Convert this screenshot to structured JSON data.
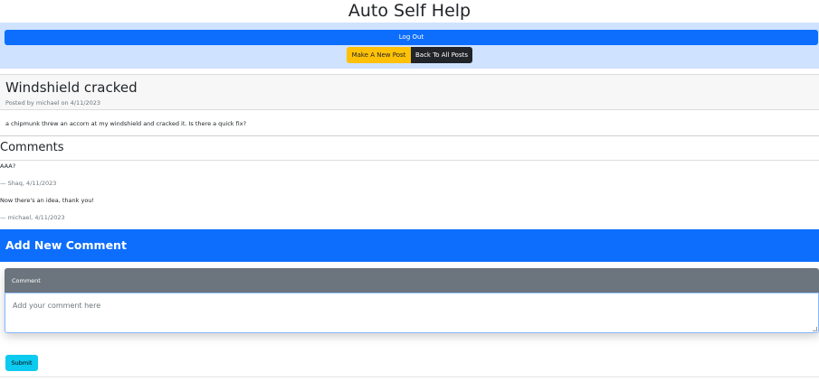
{
  "header": {
    "title": "Auto Self Help"
  },
  "nav": {
    "logout_label": "Log Out",
    "new_post_label": "Make A New Post",
    "back_label": "Back To All Posts",
    "colors": {
      "band": "#cfe2ff",
      "primary": "#0d6efd",
      "warning": "#ffc107",
      "dark": "#212529"
    }
  },
  "post": {
    "title": "Windshield cracked",
    "meta": "Posted by michael on 4/11/2023",
    "body": "a chipmunk threw an accorn at my windshield and cracked it. Is there a quick fix?"
  },
  "comments": {
    "heading": "Comments",
    "items": [
      {
        "text": "AAA?",
        "author": "— Shaq, 4/11/2023"
      },
      {
        "text": "Now there's an idea, thank you!",
        "author": "— michael, 4/11/2023"
      }
    ]
  },
  "add_comment": {
    "heading": "Add New Comment",
    "input_label": "Comment",
    "placeholder": "Add your comment here",
    "value": "",
    "submit_label": "Submit",
    "colors": {
      "band": "#0d6efd",
      "label": "#6c757d",
      "submit": "#0dcaf0"
    }
  }
}
